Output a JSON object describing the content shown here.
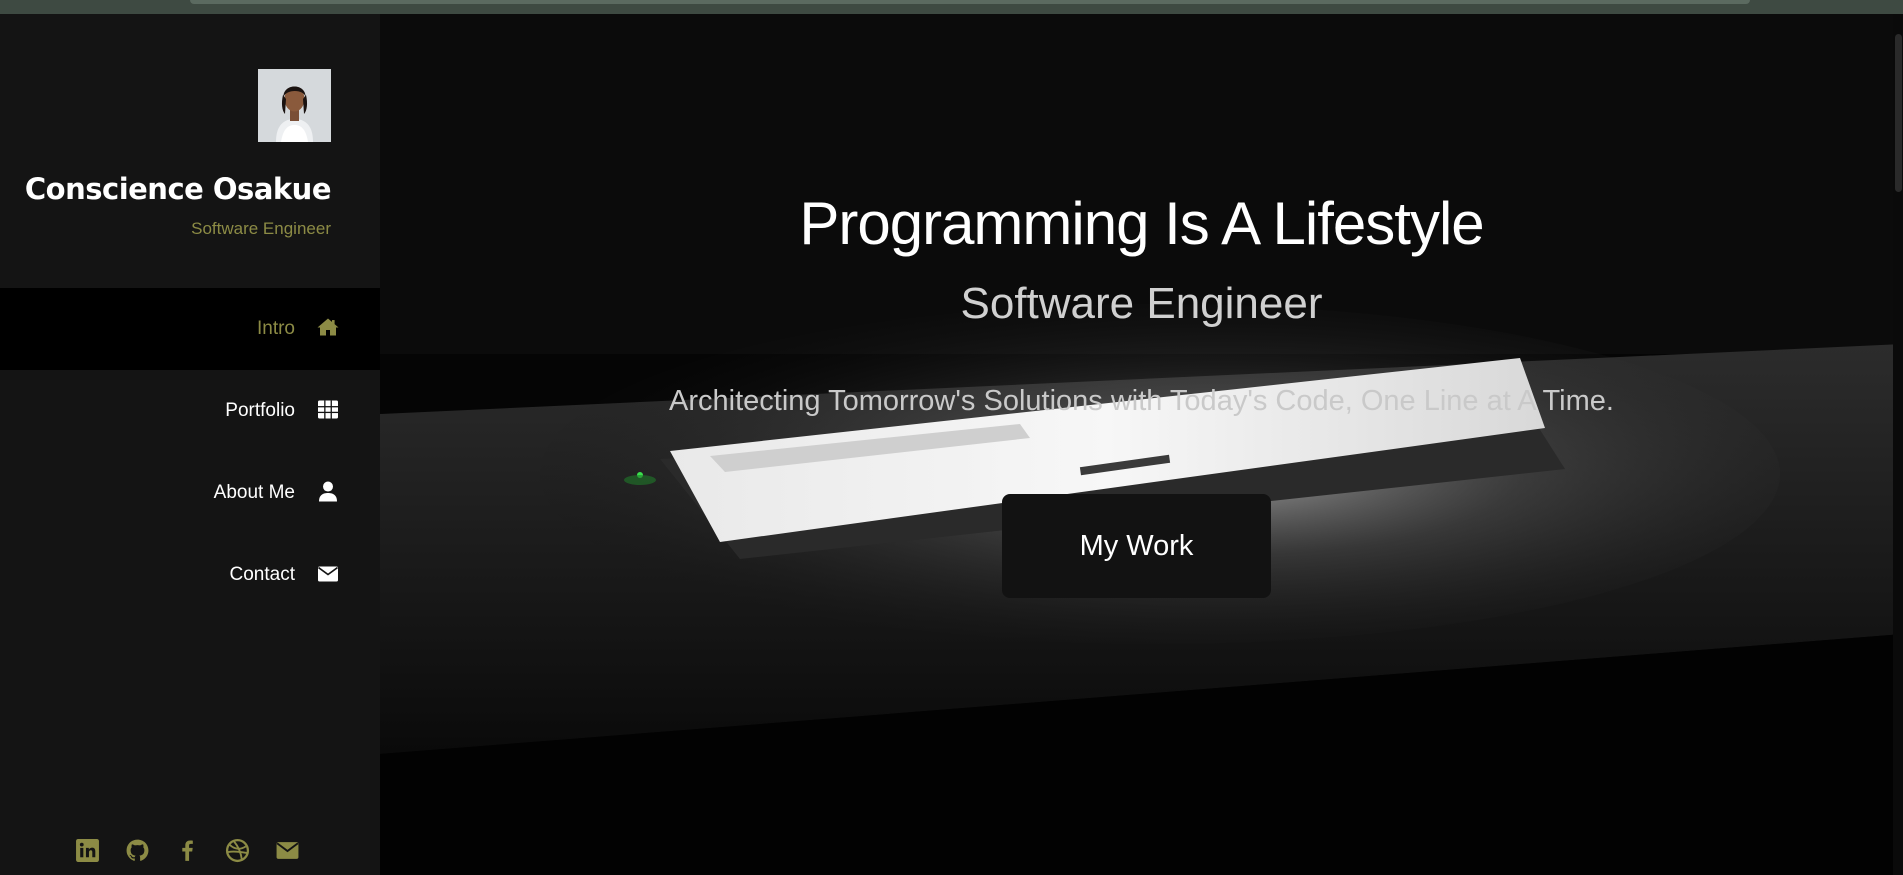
{
  "profile": {
    "name": "Conscience Osakue",
    "role": "Software Engineer"
  },
  "nav": {
    "items": [
      {
        "label": "Intro",
        "icon": "home-icon",
        "active": true
      },
      {
        "label": "Portfolio",
        "icon": "grid-icon",
        "active": false
      },
      {
        "label": "About Me",
        "icon": "user-icon",
        "active": false
      },
      {
        "label": "Contact",
        "icon": "envelope-icon",
        "active": false
      }
    ]
  },
  "social": [
    "linkedin-icon",
    "github-icon",
    "facebook-icon",
    "dribbble-icon",
    "mail-icon"
  ],
  "hero": {
    "title": "Programming Is A Lifestyle",
    "subtitle": "Software Engineer",
    "tagline": "Architecting Tomorrow's Solutions with Today's Code, One Line at A Time.",
    "button_label": "My Work"
  },
  "colors": {
    "accent": "#8c8b45",
    "sidebar_bg": "#141414",
    "active_nav_bg": "#000000",
    "button_bg": "#121212"
  }
}
